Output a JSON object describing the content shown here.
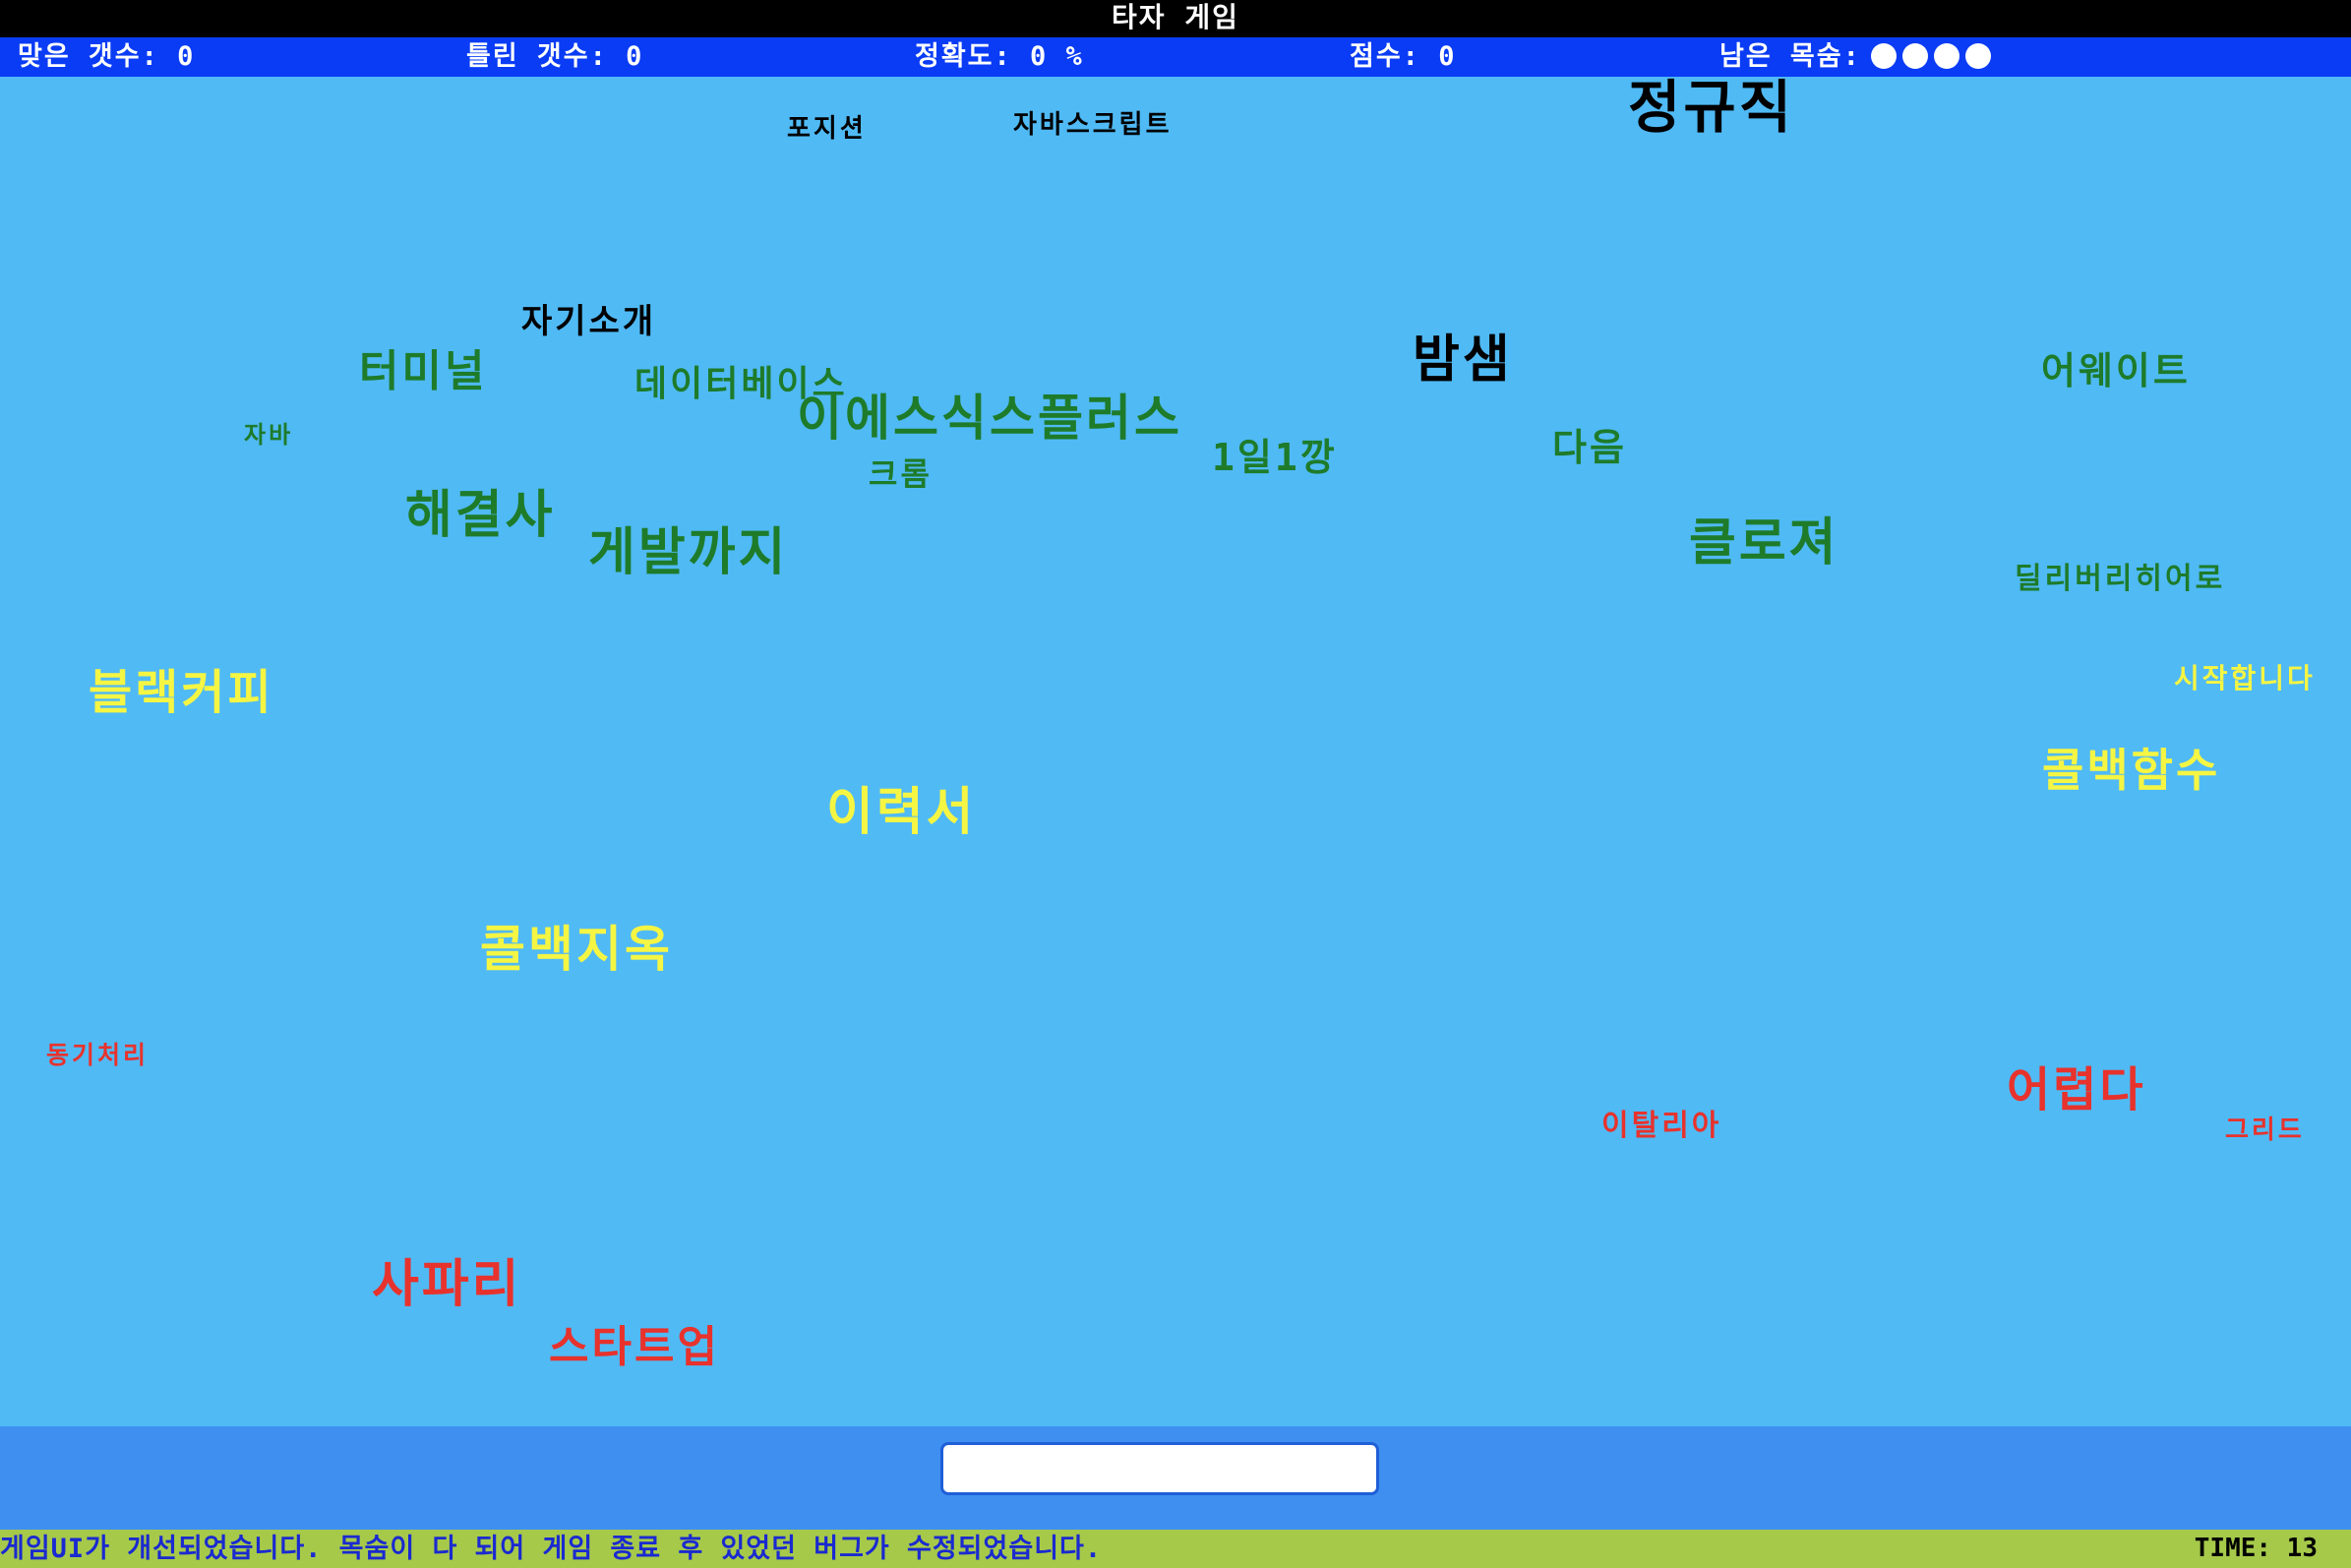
{
  "app": {
    "title": "타자 게임"
  },
  "stats": {
    "correct": "맞은 갯수: 0",
    "wrong": "틀린 갯수: 0",
    "accuracy": "정확도: 0 %",
    "score": "점수: 0",
    "lives_label": "남은 목숨:",
    "lives_count": 4
  },
  "colors": {
    "black": "#000000",
    "green": "#1e7b2a",
    "yellow": "#f5f543",
    "red": "#e8322c",
    "titlebar": "#000000",
    "statusbar": "#0a3cf5",
    "playfield": "#50baf5",
    "input_panel": "#3f8ff0",
    "notice_bar": "#a6c94a"
  },
  "words": [
    {
      "text": "정규직",
      "color": "black"
    },
    {
      "text": "포지션",
      "color": "black"
    },
    {
      "text": "자바스크립트",
      "color": "black"
    },
    {
      "text": "자기소개",
      "color": "black"
    },
    {
      "text": "밤샘",
      "color": "black"
    },
    {
      "text": "터미널",
      "color": "green"
    },
    {
      "text": "데이터베이스",
      "color": "green"
    },
    {
      "text": "이에스식스플러스",
      "color": "green"
    },
    {
      "text": "자바",
      "color": "green"
    },
    {
      "text": "1일1깡",
      "color": "green"
    },
    {
      "text": "다음",
      "color": "green"
    },
    {
      "text": "어웨이트",
      "color": "green"
    },
    {
      "text": "크롬",
      "color": "green"
    },
    {
      "text": "해결사",
      "color": "green"
    },
    {
      "text": "게발까지",
      "color": "green"
    },
    {
      "text": "클로져",
      "color": "green"
    },
    {
      "text": "딜리버리히어로",
      "color": "green"
    },
    {
      "text": "블랙커피",
      "color": "yellow"
    },
    {
      "text": "시작합니다",
      "color": "yellow"
    },
    {
      "text": "콜백함수",
      "color": "yellow"
    },
    {
      "text": "이력서",
      "color": "yellow"
    },
    {
      "text": "콜백지옥",
      "color": "yellow"
    },
    {
      "text": "동기처리",
      "color": "red"
    },
    {
      "text": "어렵다",
      "color": "red"
    },
    {
      "text": "이탈리아",
      "color": "red"
    },
    {
      "text": "그리드",
      "color": "red"
    },
    {
      "text": "사파리",
      "color": "red"
    },
    {
      "text": "스타트업",
      "color": "red"
    }
  ],
  "input": {
    "value": "",
    "placeholder": ""
  },
  "footer": {
    "notice": "게임UI가 개선되었습니다. 목숨이 다 되어 게임 종료 후 있었던 버그가 수정되었습니다.",
    "timer": "TIME: 13"
  }
}
